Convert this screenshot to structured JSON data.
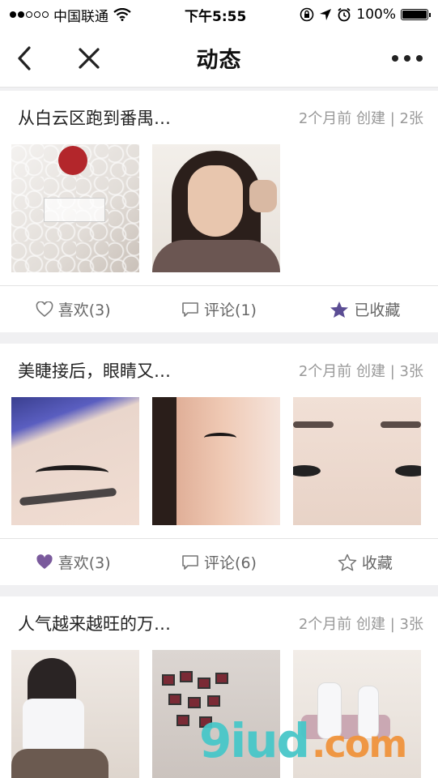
{
  "status_bar": {
    "carrier": "中国联通",
    "time": "下午5:55",
    "battery": "100%"
  },
  "nav": {
    "title": "动态"
  },
  "accent_color": "#5b4d94",
  "posts": [
    {
      "title": "从白云区跑到番禺…",
      "meta": "2个月前 创建 | 2张",
      "like_label": "喜欢(3)",
      "comment_label": "评论(1)",
      "favorite_label": "已收藏",
      "liked": false,
      "favorited": true
    },
    {
      "title": "美睫接后，眼睛又…",
      "meta": "2个月前 创建 | 3张",
      "like_label": "喜欢(3)",
      "comment_label": "评论(6)",
      "favorite_label": "收藏",
      "liked": true,
      "favorited": false
    },
    {
      "title": "人气越来越旺的万…",
      "meta": "2个月前 创建 | 3张"
    }
  ],
  "watermark": {
    "brand": "9iud",
    "suffix": ".com"
  }
}
